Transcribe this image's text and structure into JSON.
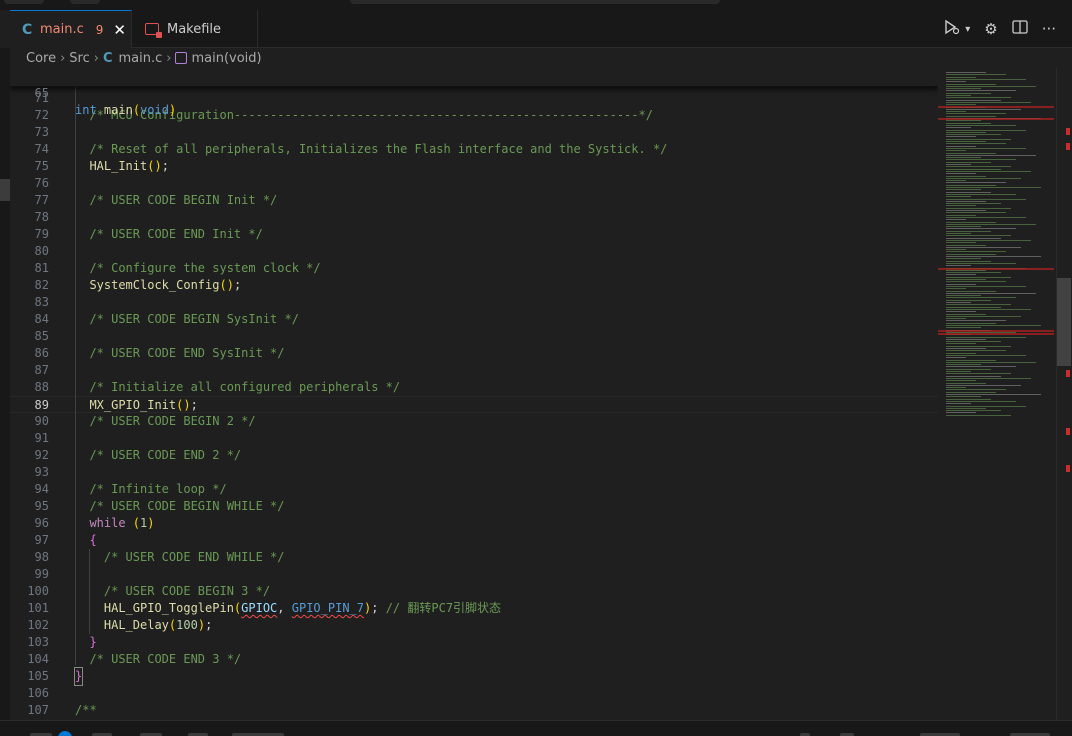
{
  "tabs": [
    {
      "label": "main.c",
      "problems": "9",
      "icon": "c-file-icon"
    },
    {
      "label": "Makefile",
      "icon": "makefile-icon"
    }
  ],
  "breadcrumb": {
    "items": [
      "Core",
      "Src",
      "main.c",
      "main(void)"
    ]
  },
  "editor": {
    "sticky": {
      "num": "65",
      "code": "int main(void)"
    },
    "current_line": "89",
    "lines": [
      {
        "num": "71",
        "code": ""
      },
      {
        "num": "72",
        "code": "/* MCU Configuration--------------------------------------------------------*/"
      },
      {
        "num": "73",
        "code": ""
      },
      {
        "num": "74",
        "code": "/* Reset of all peripherals, Initializes the Flash interface and the Systick. */"
      },
      {
        "num": "75",
        "code": "HAL_Init();"
      },
      {
        "num": "76",
        "code": ""
      },
      {
        "num": "77",
        "code": "/* USER CODE BEGIN Init */"
      },
      {
        "num": "78",
        "code": ""
      },
      {
        "num": "79",
        "code": "/* USER CODE END Init */"
      },
      {
        "num": "80",
        "code": ""
      },
      {
        "num": "81",
        "code": "/* Configure the system clock */"
      },
      {
        "num": "82",
        "code": "SystemClock_Config();"
      },
      {
        "num": "83",
        "code": ""
      },
      {
        "num": "84",
        "code": "/* USER CODE BEGIN SysInit */"
      },
      {
        "num": "85",
        "code": ""
      },
      {
        "num": "86",
        "code": "/* USER CODE END SysInit */"
      },
      {
        "num": "87",
        "code": ""
      },
      {
        "num": "88",
        "code": "/* Initialize all configured peripherals */"
      },
      {
        "num": "89",
        "code": "MX_GPIO_Init();"
      },
      {
        "num": "90",
        "code": "/* USER CODE BEGIN 2 */"
      },
      {
        "num": "91",
        "code": ""
      },
      {
        "num": "92",
        "code": "/* USER CODE END 2 */"
      },
      {
        "num": "93",
        "code": ""
      },
      {
        "num": "94",
        "code": "/* Infinite loop */"
      },
      {
        "num": "95",
        "code": "/* USER CODE BEGIN WHILE */"
      },
      {
        "num": "96",
        "code": "while (1)"
      },
      {
        "num": "97",
        "code": "{"
      },
      {
        "num": "98",
        "code": "/* USER CODE END WHILE */"
      },
      {
        "num": "99",
        "code": ""
      },
      {
        "num": "100",
        "code": "/* USER CODE BEGIN 3 */"
      },
      {
        "num": "101",
        "code": "HAL_GPIO_TogglePin(GPIOC, GPIO_PIN_7); // 翻转PC7引脚状态"
      },
      {
        "num": "102",
        "code": "HAL_Delay(100);"
      },
      {
        "num": "103",
        "code": "}"
      },
      {
        "num": "104",
        "code": "/* USER CODE END 3 */"
      },
      {
        "num": "105",
        "code": "}"
      },
      {
        "num": "106",
        "code": ""
      },
      {
        "num": "107",
        "code": "/**"
      }
    ]
  },
  "colors": {
    "accent": "#0078d4",
    "error": "#f14c4c",
    "comment": "#6a9955",
    "function": "#dcdcaa",
    "keyword": "#569cd6"
  },
  "icons": [
    "c-file-icon",
    "close-icon",
    "makefile-icon",
    "run-debug-icon",
    "chevron-down-icon",
    "settings-gear-icon",
    "split-editor-icon",
    "more-actions-icon",
    "symbol-method-icon"
  ]
}
